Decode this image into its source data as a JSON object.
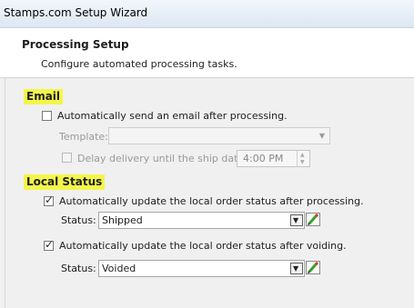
{
  "window": {
    "title": "Stamps.com Setup Wizard"
  },
  "header": {
    "title": "Processing Setup",
    "subtitle": "Configure automated processing tasks."
  },
  "email": {
    "section_title": "Email",
    "send_email_label": "Automatically send an email after processing.",
    "send_email_checked": false,
    "template_label": "Template:",
    "template_value": "",
    "delay_label": "Delay delivery until the ship date at",
    "delay_checked": false,
    "delay_time": "4:00 PM"
  },
  "local_status": {
    "section_title": "Local Status",
    "after_processing": {
      "label": "Automatically update the local order status after processing.",
      "checked": true,
      "status_label": "Status:",
      "status_value": "Shipped"
    },
    "after_voiding": {
      "label": "Automatically update the local order status after voiding.",
      "checked": true,
      "status_label": "Status:",
      "status_value": "Voided"
    }
  },
  "icons": {
    "dropdown": "chevron-down-icon",
    "edit": "pencil-icon",
    "spin_up": "spin-up-icon",
    "spin_down": "spin-down-icon"
  },
  "colors": {
    "section_highlight": "#f4f54a",
    "pencil_green": "#3aa02c",
    "pencil_red": "#d43b2a"
  }
}
